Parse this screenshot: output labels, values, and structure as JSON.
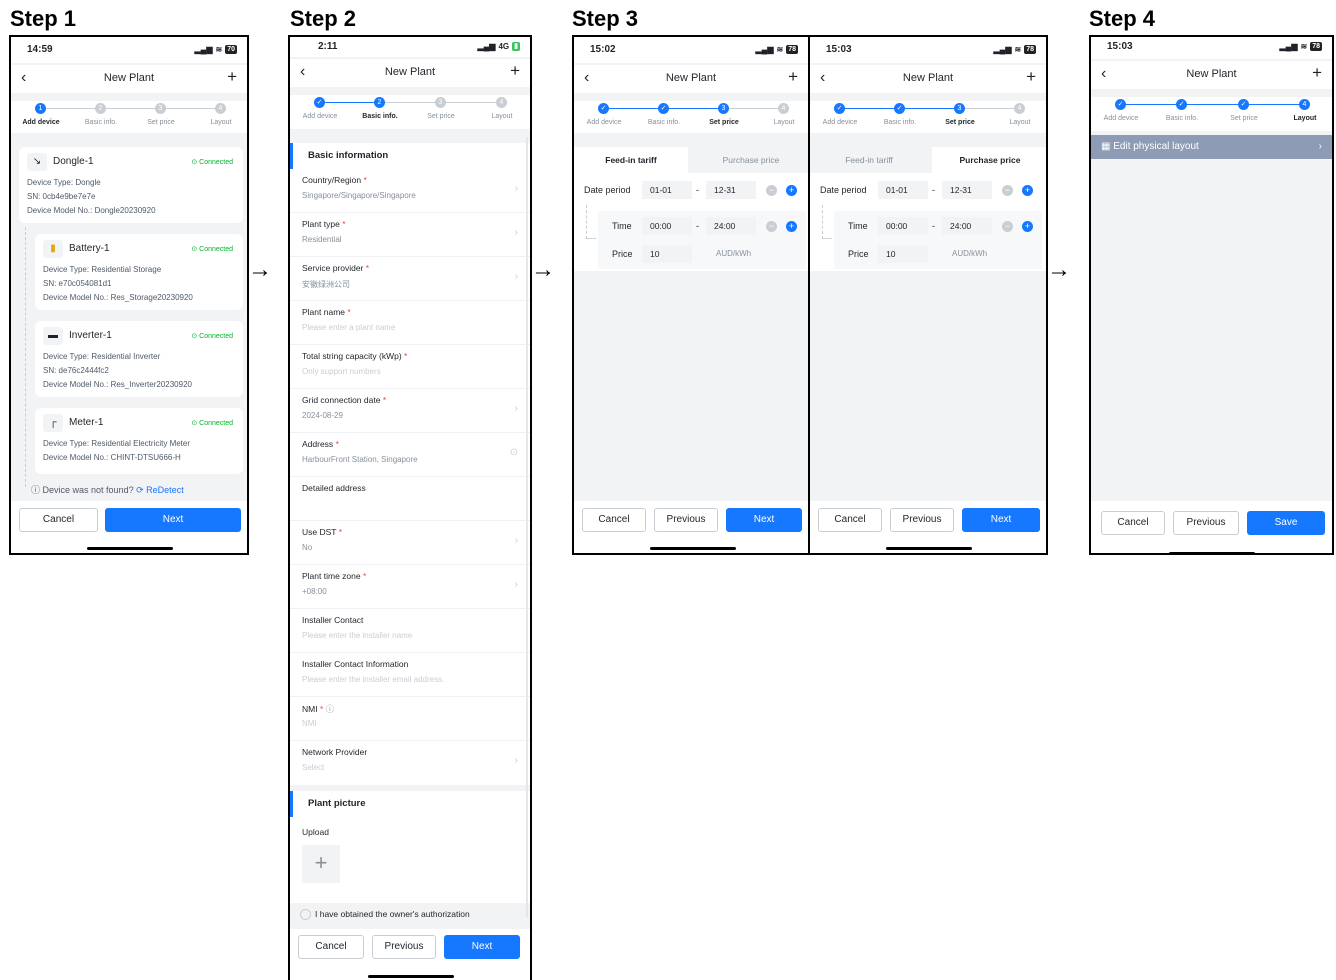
{
  "steps": [
    "Step 1",
    "Step 2",
    "Step 3",
    "Step 4"
  ],
  "arrow": "→",
  "nav": {
    "back": "‹",
    "title": "New Plant",
    "plus": "+"
  },
  "stepper_labels": [
    "Add device",
    "Basic info.",
    "Set price",
    "Layout"
  ],
  "buttons": {
    "cancel": "Cancel",
    "next": "Next",
    "previous": "Previous",
    "save": "Save"
  },
  "step1": {
    "time": "14:59",
    "battery": "70",
    "devices": [
      {
        "name": "Dongle-1",
        "status": "Connected",
        "type": "Device Type: Dongle",
        "sn": "SN: 0cb4e9be7e7e",
        "model": "Device Model No.: Dongle20230920"
      },
      {
        "name": "Battery-1",
        "status": "Connected",
        "type": "Device Type: Residential Storage",
        "sn": "SN: e70c054081d1",
        "model": "Device Model No.: Res_Storage20230920"
      },
      {
        "name": "Inverter-1",
        "status": "Connected",
        "type": "Device Type: Residential Inverter",
        "sn": "SN: de76c2444fc2",
        "model": "Device Model No.: Res_Inverter20230920"
      },
      {
        "name": "Meter-1",
        "status": "Connected",
        "type": "Device Type: Residential Electricity Meter",
        "model": "Device Model No.: CHINT-DTSU666-H"
      }
    ],
    "not_found": "Device was not found?",
    "redetect": "ReDetect"
  },
  "step2": {
    "time": "2:11",
    "signal": "4G",
    "section_basic": "Basic information",
    "fields": [
      {
        "label": "Country/Region",
        "value": "Singapore/Singapore/Singapore"
      },
      {
        "label": "Plant type",
        "value": "Residential"
      },
      {
        "label": "Service provider",
        "value": "安徽绿洲公司"
      },
      {
        "label": "Plant name",
        "value": "Please enter a plant name"
      },
      {
        "label": "Total string capacity (kWp)",
        "value": "Only support numbers"
      },
      {
        "label": "Grid connection date",
        "value": "2024-08-29"
      },
      {
        "label": "Address",
        "value": "HarbourFront Station, Singapore"
      },
      {
        "label": "Detailed address",
        "value": ""
      },
      {
        "label": "Use DST",
        "value": "No"
      },
      {
        "label": "Plant time zone",
        "value": "+08:00"
      },
      {
        "label": "Installer Contact",
        "value": "Please enter the installer name"
      },
      {
        "label": "Installer Contact Information",
        "value": "Please enter the installer email address."
      },
      {
        "label": "NMI",
        "value": "NMI"
      },
      {
        "label": "Network Provider",
        "value": "Select"
      }
    ],
    "section_picture": "Plant picture",
    "upload": "Upload",
    "auth": "I have obtained the owner's authorization"
  },
  "step3": {
    "time_a": "15:02",
    "time_b": "15:03",
    "battery": "78",
    "tab_feed": "Feed-in tariff",
    "tab_purchase": "Purchase price",
    "date_period": "Date period",
    "date_from": "01-01",
    "date_to": "12-31",
    "time_label": "Time",
    "time_from": "00:00",
    "time_to": "24:00",
    "price_label": "Price",
    "price_value": "10",
    "unit": "AUD/kWh",
    "dash": "-"
  },
  "step4": {
    "time": "15:03",
    "edit_layout": "Edit physical layout"
  }
}
